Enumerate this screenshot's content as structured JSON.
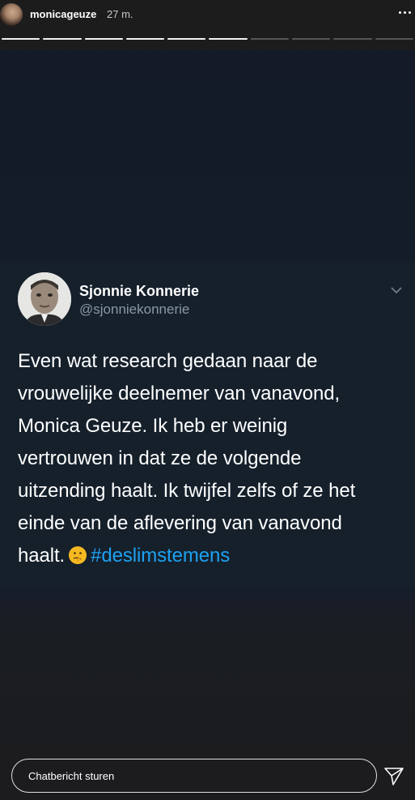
{
  "header": {
    "username": "monicageuze",
    "timestamp": "27 m.",
    "progress": {
      "total": 10,
      "completed": 6
    },
    "more_icon": "more-horizontal-icon"
  },
  "tweet": {
    "display_name": "Sjonnie Konnerie",
    "handle": "@sjonniekonnerie",
    "lines": [
      "Even wat research gedaan naar de",
      "vrouwelijke deelnemer van vanavond,",
      "Monica Geuze. Ik heb er weinig",
      "vertrouwen in dat ze de volgende",
      "uitzending haalt. Ik twijfel zelfs of ze het",
      "einde van de aflevering van vanavond"
    ],
    "last_line_text": "haalt.",
    "emoji": "thinking-face-icon",
    "hashtag": "#deslimstemens",
    "hashtag_color": "#1da1f2"
  },
  "footer": {
    "chat_placeholder": "Chatbericht sturen",
    "send_icon": "send-icon"
  }
}
